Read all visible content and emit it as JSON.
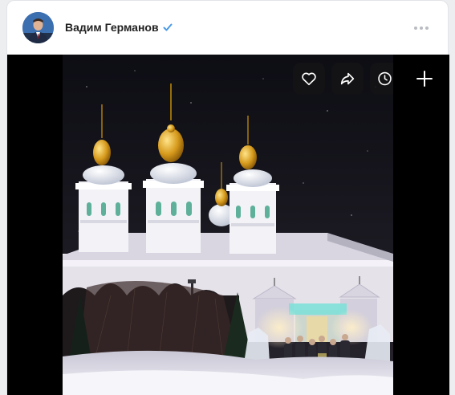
{
  "post": {
    "author_name": "Вадим Германов",
    "author_verified": true
  },
  "icons": {
    "avatar": "author-avatar",
    "verified": "verified-check-icon",
    "more": "more-dots-icon",
    "like": "heart-icon",
    "share": "share-arrow-icon",
    "watch_later": "clock-icon",
    "add": "plus-icon"
  },
  "colors": {
    "verified": "#4a9ae8",
    "button_bg": "#141416",
    "icon": "#ffffff"
  }
}
